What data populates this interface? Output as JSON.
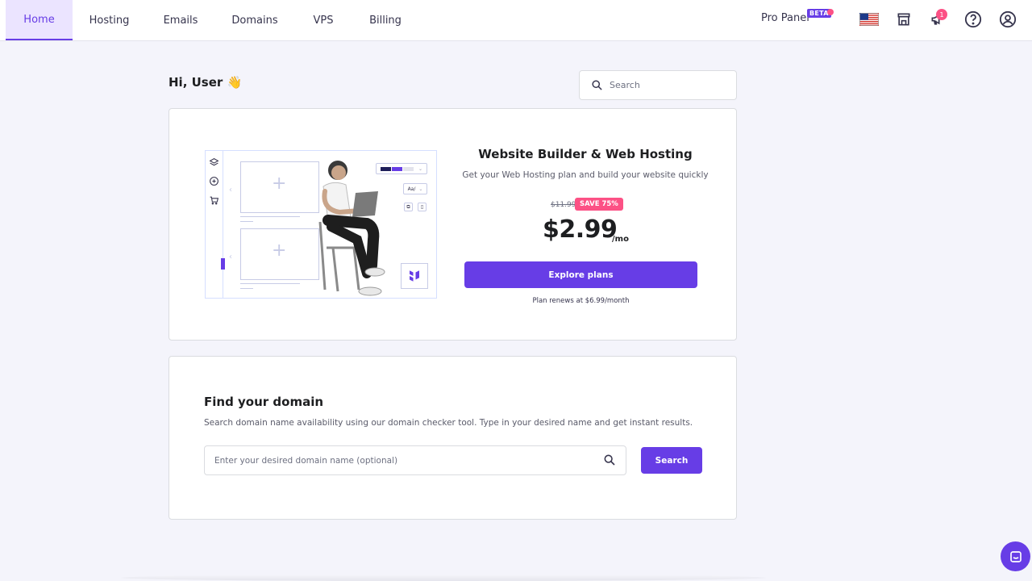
{
  "nav": {
    "tabs": [
      {
        "label": "Home",
        "active": true
      },
      {
        "label": "Hosting",
        "active": false
      },
      {
        "label": "Emails",
        "active": false
      },
      {
        "label": "Domains",
        "active": false
      },
      {
        "label": "VPS",
        "active": false
      },
      {
        "label": "Billing",
        "active": false
      }
    ],
    "pro_panel_label": "Pro Panel",
    "beta_label": "BETA",
    "notification_count": "1",
    "icons": [
      "us-flag-icon",
      "store-icon",
      "megaphone-icon",
      "help-icon",
      "account-icon"
    ]
  },
  "greeting": {
    "text": "Hi, User",
    "emoji": "👋"
  },
  "search": {
    "placeholder": "Search"
  },
  "hosting_card": {
    "title": "Website Builder & Web Hosting",
    "subtitle": "Get your Web Hosting plan and build your website quickly",
    "old_price": "$11.99",
    "save_badge": "SAVE 75%",
    "price": "$2.99",
    "per": "/mo",
    "cta_label": "Explore plans",
    "renews_text": "Plan renews at $6.99/month",
    "illustration": {
      "font_chip": "Aa/"
    }
  },
  "domain_card": {
    "title": "Find your domain",
    "description": "Search domain name availability using our domain checker tool. Type in your desired name and get instant results.",
    "input_placeholder": "Enter your desired domain name (optional)",
    "button_label": "Search"
  },
  "colors": {
    "accent": "#673de6",
    "accent_light": "#ebe4ff",
    "badge": "#fc5185",
    "background": "#f4f4fb"
  }
}
